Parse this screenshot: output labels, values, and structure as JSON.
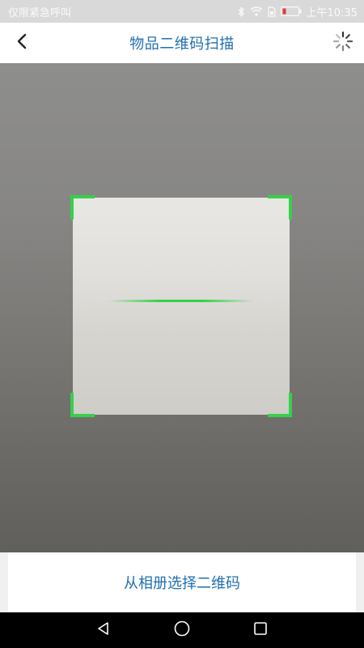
{
  "status_bar": {
    "carrier_text": "仅限紧急呼叫",
    "time": "上午10:35",
    "icons": [
      "bluetooth-icon",
      "wifi-icon",
      "sim-icon",
      "battery-icon"
    ]
  },
  "header": {
    "title": "物品二维码扫描",
    "back_icon": "chevron-left-icon",
    "right_icon": "loading-spinner-icon"
  },
  "scanner": {
    "frame_color": "#35d14a",
    "scan_line_color": "#35d14a"
  },
  "bottom": {
    "album_label": "从相册选择二维码"
  },
  "nav_bar": {
    "icons": [
      "back-triangle-icon",
      "home-circle-icon",
      "recents-square-icon"
    ]
  },
  "colors": {
    "accent": "#1f6fb0",
    "status_bar": "#d9d9d9"
  }
}
